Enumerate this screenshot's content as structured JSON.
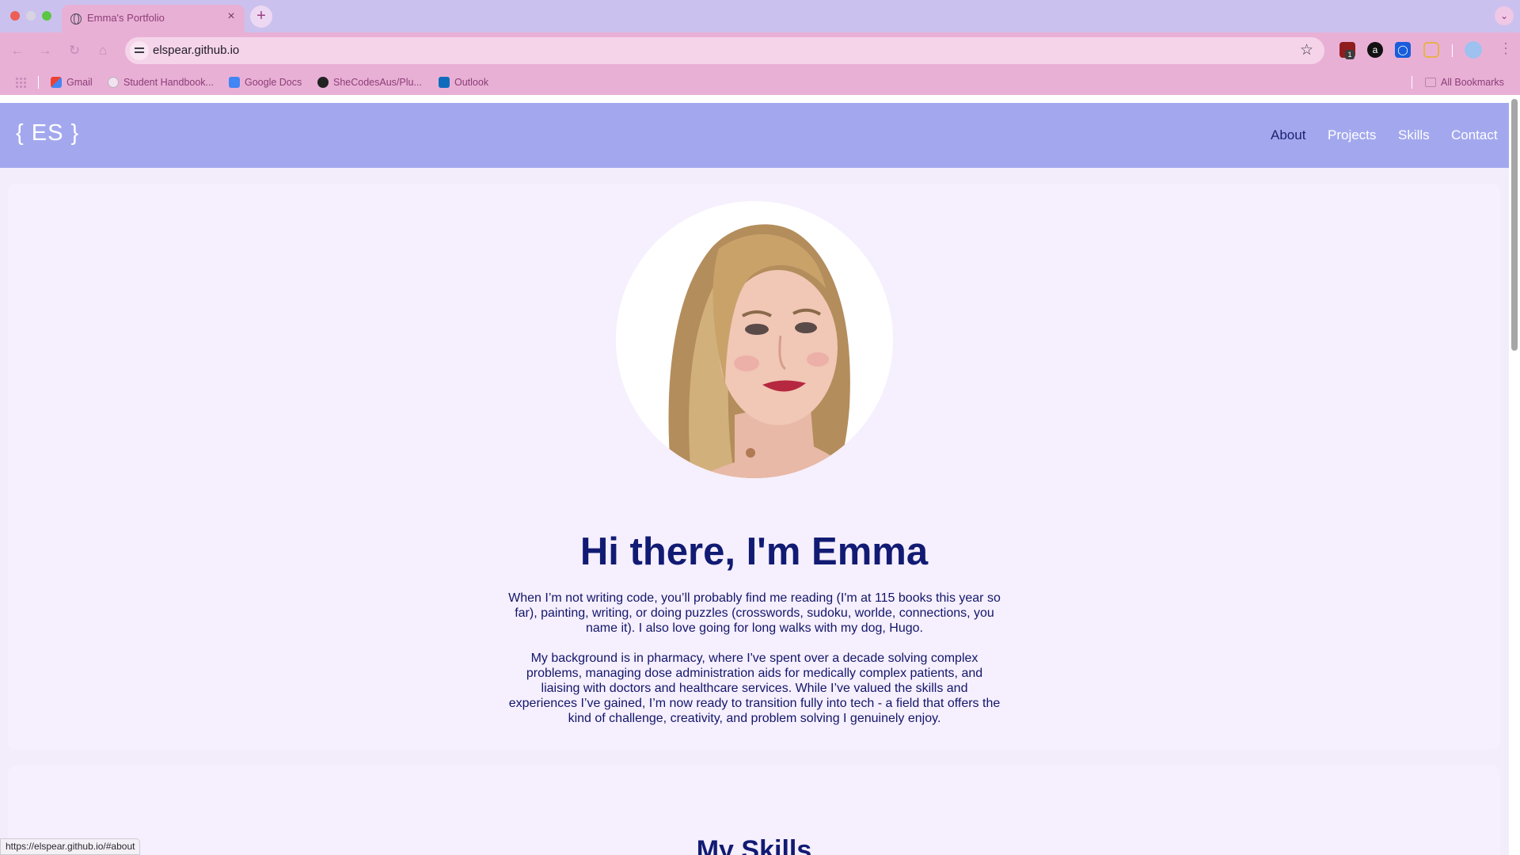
{
  "browser": {
    "tab_title": "Emma's Portfolio",
    "tab_close": "×",
    "new_tab": "+",
    "tab_menu": "⌄",
    "url": "elspear.github.io",
    "bookmarks": [
      "Gmail",
      "Student Handbook...",
      "Google Docs",
      "SheCodesAus/Plu...",
      "Outlook"
    ],
    "all_bookmarks": "All Bookmarks",
    "ext_badge": "1",
    "status_url": "https://elspear.github.io/#about"
  },
  "site": {
    "logo": "{ ES }",
    "nav": [
      "About",
      "Projects",
      "Skills",
      "Contact"
    ],
    "active_nav": "About",
    "hero_title": "Hi there, I'm Emma",
    "paragraph_1": "When I’m not writing code, you’ll probably find me reading (I'm at 115 books this year so far), painting, writing, or doing puzzles (crosswords, sudoku, worlde, connections, you name it). I also love going for long walks with my dog, Hugo.",
    "paragraph_2": "My background is in pharmacy, where I've spent over a decade solving complex problems, managing dose administration aids for medically complex patients, and liaising with doctors and healthcare services. While I’ve valued the skills and experiences I’ve gained, I’m now ready to transition fully into tech - a field that offers the kind of challenge, creativity, and problem solving I genuinely enjoy.",
    "skills_title": "My Skills"
  },
  "colors": {
    "nav_bg": "#a3a8ee",
    "heading": "#111b73",
    "card_bg": "#f6effd",
    "chrome_pink": "#e9b0d6",
    "tabstrip": "#cbc1ee"
  }
}
